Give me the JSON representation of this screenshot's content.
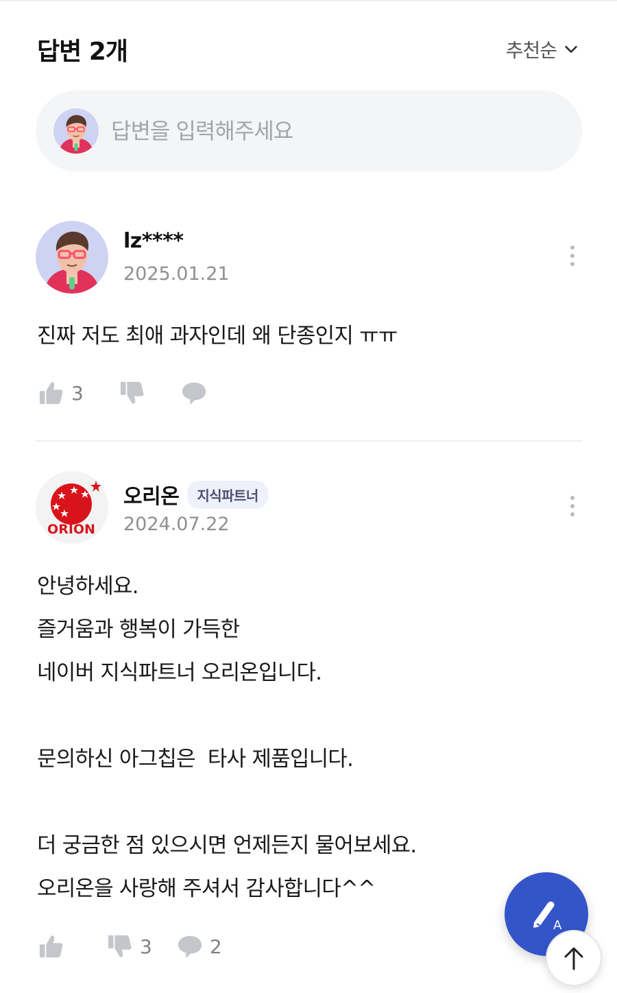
{
  "header": {
    "title": "답변 2개",
    "sort_label": "추천순"
  },
  "answer_input": {
    "placeholder": "답변을 입력해주세요"
  },
  "answers": [
    {
      "author": "lz****",
      "date": "2025.01.21",
      "body": [
        "진짜 저도 최애 과자인데 왜 단종인지 ㅠㅠ"
      ],
      "likes": "3",
      "dislikes": "",
      "comments": ""
    },
    {
      "author": "오리온",
      "badge": "지식파트너",
      "avatar_logo_text": "ORION",
      "date": "2024.07.22",
      "body": [
        "안녕하세요.",
        "즐거움과 행복이 가득한",
        "네이버 지식파트너 오리온입니다.",
        "",
        "문의하신 아그칩은  타사 제품입니다.",
        "",
        "더 궁금한 점 있으시면 언제든지 물어보세요.",
        "오리온을 사랑해 주셔서 감사합니다^^"
      ],
      "likes": "",
      "dislikes": "3",
      "comments": "2"
    }
  ],
  "icons": {
    "sort": "chevron-down-icon",
    "like": "thumbs-up-icon",
    "dislike": "thumbs-down-icon",
    "comment": "speech-bubble-icon",
    "more": "more-vertical-icon",
    "write": "pen-write-icon",
    "scroll_top": "arrow-up-icon"
  },
  "colors": {
    "primary_fab": "#3454c9",
    "icon_gray": "#c4c6cb",
    "badge_bg": "#eef0fb",
    "orion_red": "#d8141b"
  }
}
